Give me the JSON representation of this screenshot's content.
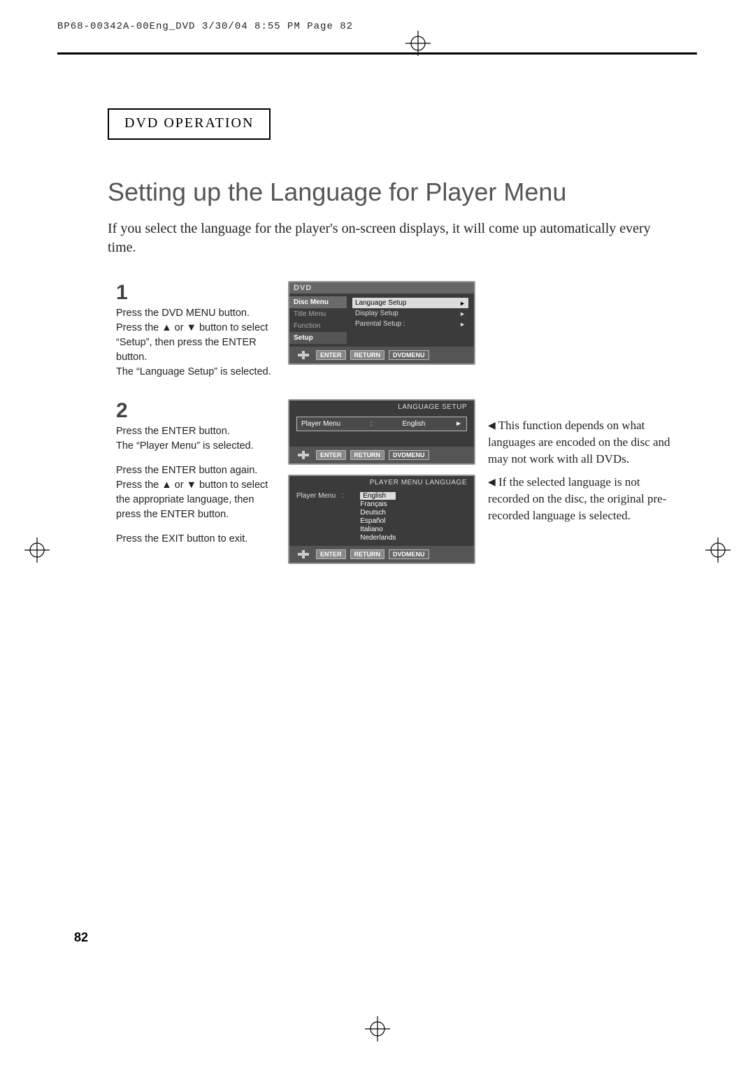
{
  "header_code": "BP68-00342A-00Eng_DVD  3/30/04  8:55 PM  Page 82",
  "section_label": "DVD OPERATION",
  "title": "Setting up the Language for Player Menu",
  "intro": "If you select the language for the player's on-screen displays, it will come up automatically every time.",
  "step1": {
    "num": "1",
    "l1": "Press the DVD MENU button.",
    "l2": "Press the ▲ or ▼ button to select “Setup”, then press the ENTER button.",
    "l3": "The “Language Setup” is selected."
  },
  "step2": {
    "num": "2",
    "l1": "Press the ENTER button.",
    "l2": "The “Player Menu” is selected.",
    "l3": "Press the ENTER button again.",
    "l4": "Press the ▲ or ▼ button to select the appropriate language, then press the ENTER button.",
    "l5": "Press the EXIT button to exit."
  },
  "osd1": {
    "top": "DVD",
    "side": [
      "Disc Menu",
      "Title Menu",
      "Function",
      "Setup"
    ],
    "rows": [
      {
        "label": "Language Setup",
        "arrow": "►"
      },
      {
        "label": "Display Setup",
        "arrow": "►"
      },
      {
        "label": "Parental Setup  :",
        "arrow": "►"
      }
    ],
    "btns": [
      "ENTER",
      "RETURN",
      "DVDMENU"
    ]
  },
  "osd2": {
    "header": "LANGUAGE SETUP",
    "label": "Player Menu",
    "colon": ":",
    "value": "English",
    "arrow": "►",
    "btns": [
      "ENTER",
      "RETURN",
      "DVDMENU"
    ]
  },
  "osd3": {
    "header": "PLAYER MENU LANGUAGE",
    "label": "Player Menu",
    "colon": ":",
    "langs": [
      "English",
      "Français",
      "Deutsch",
      "Español",
      "Italiano",
      "Nederlands"
    ],
    "btns": [
      "ENTER",
      "RETURN",
      "DVDMENU"
    ]
  },
  "notes": {
    "n1": "This function depends on what languages are encoded on the disc and may not work with all DVDs.",
    "n2": "If the selected language is not recorded on the disc, the original pre-recorded language is selected."
  },
  "page_num": "82"
}
